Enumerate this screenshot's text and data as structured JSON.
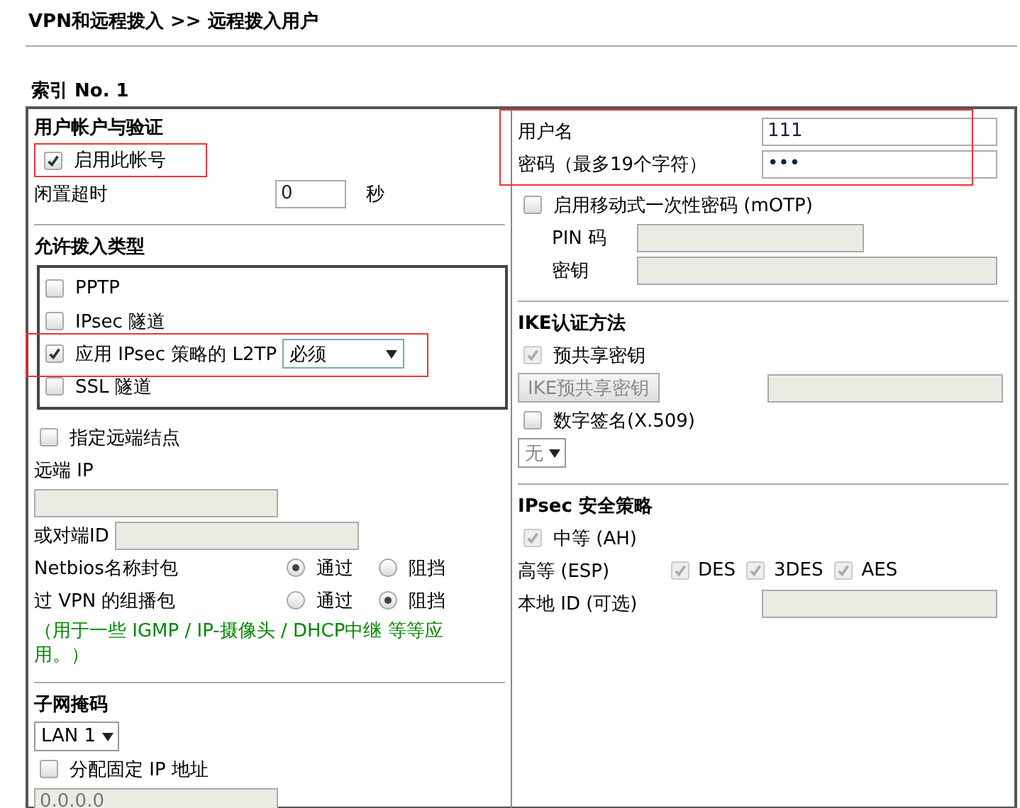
{
  "breadcrumb": "VPN和远程拨入 >> 远程拨入用户",
  "index_label": "索引 No. 1",
  "left": {
    "account": {
      "heading": "用户帐户与验证",
      "enable": {
        "label": "启用此帐号",
        "checked": true,
        "highlighted": true
      },
      "idle": {
        "label": "闲置超时",
        "value": "0",
        "unit": "秒"
      }
    },
    "dial_in": {
      "heading": "允许拨入类型",
      "types": [
        {
          "label": "PPTP",
          "checked": false,
          "highlighted": false
        },
        {
          "label": "IPsec 隧道",
          "checked": false,
          "highlighted": false
        },
        {
          "label": "应用 IPsec 策略的 L2TP",
          "checked": true,
          "highlighted": true,
          "select": "必须"
        },
        {
          "label": "SSL 隧道",
          "checked": false,
          "highlighted": false
        }
      ]
    },
    "remote_node": {
      "label": "指定远端结点",
      "checked": false
    },
    "remote_ip": {
      "label": "远端 IP"
    },
    "peer_id": {
      "label": "或对端ID"
    },
    "packets": [
      {
        "label": "Netbios名称封包",
        "options": [
          {
            "label": "通过",
            "selected": true
          },
          {
            "label": "阻挡",
            "selected": false
          }
        ]
      },
      {
        "label": "过 VPN 的组播包",
        "options": [
          {
            "label": "通过",
            "selected": false
          },
          {
            "label": "阻挡",
            "selected": true
          }
        ]
      }
    ],
    "note": "（用于一些 IGMP / IP-摄像头 / DHCP中继 等等应用。）",
    "subnet": {
      "heading": "子网掩码",
      "select": "LAN 1",
      "fixed_ip": {
        "label": "分配固定 IP 地址",
        "checked": false
      },
      "ip_value": "0.0.0.0"
    }
  },
  "right": {
    "credentials": {
      "highlighted": true,
      "fields": [
        {
          "label": "用户名",
          "value": "111"
        },
        {
          "label": "密码（最多19个字符）",
          "value": "•••"
        }
      ]
    },
    "motp": {
      "label": "启用移动式一次性密码 (mOTP)",
      "checked": false,
      "fields": [
        {
          "label": "PIN 码"
        },
        {
          "label": "密钥"
        }
      ]
    },
    "ike": {
      "heading": "IKE认证方法",
      "psk": {
        "label": "预共享密钥",
        "checked": true,
        "disabled": true
      },
      "psk_button": "IKE预共享密钥",
      "cert": {
        "label": "数字签名(X.509)",
        "checked": false,
        "disabled": false
      },
      "cert_select": "无"
    },
    "ipsec": {
      "heading": "IPsec 安全策略",
      "medium": {
        "label": "中等 (AH)",
        "checked": true,
        "disabled": true
      },
      "high": {
        "label": "高等 (ESP)",
        "algorithms": [
          {
            "label": "DES",
            "checked": true,
            "disabled": true
          },
          {
            "label": "3DES",
            "checked": true,
            "disabled": true
          },
          {
            "label": "AES",
            "checked": true,
            "disabled": true
          }
        ]
      },
      "local_id": {
        "label": "本地 ID (可选)"
      }
    }
  }
}
